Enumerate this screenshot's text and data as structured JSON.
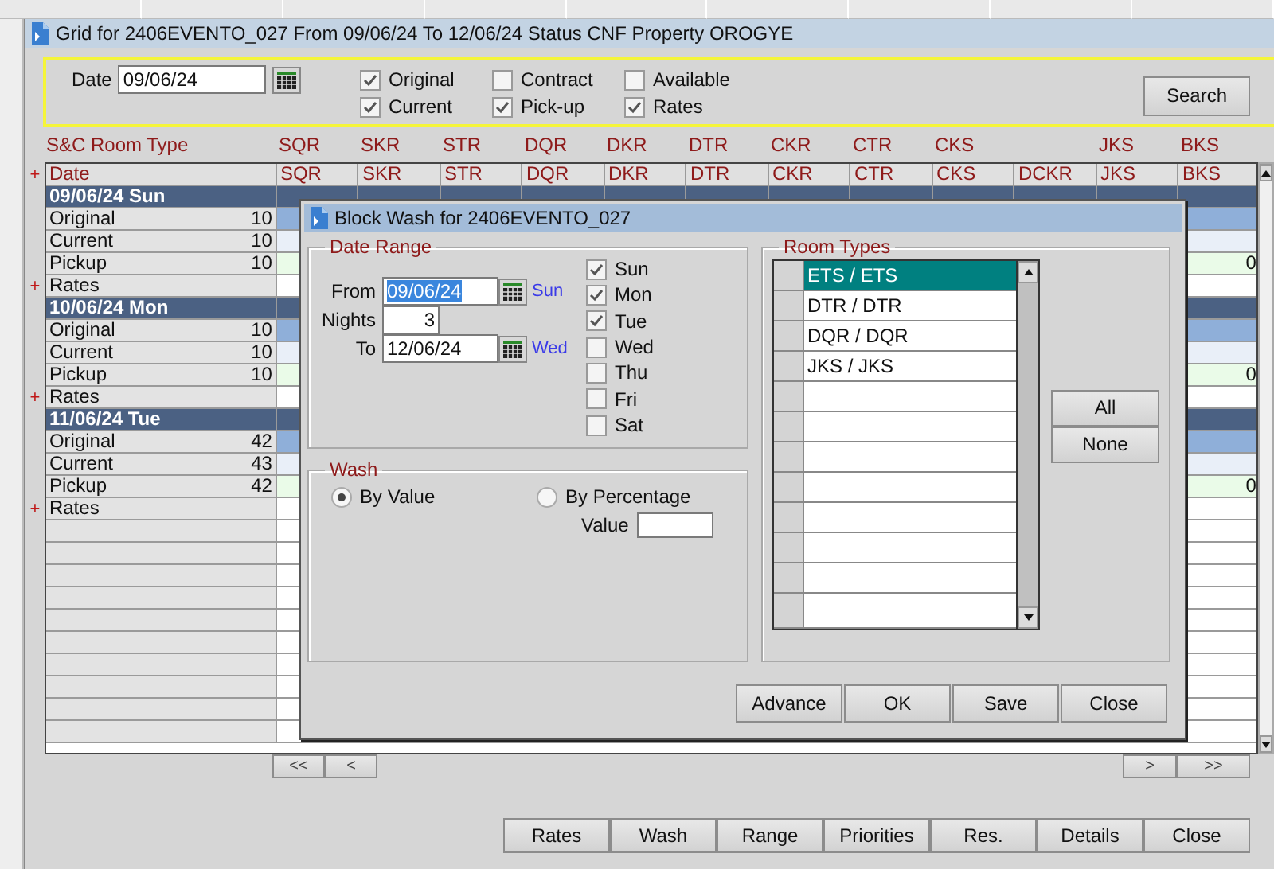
{
  "window": {
    "title": "Grid for 2406EVENTO_027 From 09/06/24 To 12/06/24 Status CNF Property OROGYE"
  },
  "filter": {
    "date_label": "Date",
    "date_value": "09/06/24",
    "options": [
      {
        "label": "Original",
        "checked": true
      },
      {
        "label": "Current",
        "checked": true
      },
      {
        "label": "Contract",
        "checked": false
      },
      {
        "label": "Pick-up",
        "checked": true
      },
      {
        "label": "Available",
        "checked": false
      },
      {
        "label": "Rates",
        "checked": true
      }
    ],
    "search_button": "Search"
  },
  "grid": {
    "room_type_label": "S&C Room Type",
    "date_heading": "Date",
    "date_marker": "+",
    "columns": [
      {
        "code": "SQR",
        "room_type": "SQR"
      },
      {
        "code": "SKR",
        "room_type": "SKR"
      },
      {
        "code": "STR",
        "room_type": "STR"
      },
      {
        "code": "DQR",
        "room_type": "DQR"
      },
      {
        "code": "DKR",
        "room_type": "DKR"
      },
      {
        "code": "DTR",
        "room_type": "DTR"
      },
      {
        "code": "CKR",
        "room_type": "CKR"
      },
      {
        "code": "CTR",
        "room_type": "CTR"
      },
      {
        "code": "CKS",
        "room_type": "CKS"
      },
      {
        "code": "DCKR"
      },
      {
        "code": "JKS",
        "room_type": "JKS"
      },
      {
        "code": "BKS",
        "room_type": "BKS"
      }
    ],
    "rows": [
      {
        "kind": "date",
        "label": "09/06/24 Sun"
      },
      {
        "kind": "original",
        "label": "Original",
        "value": "10"
      },
      {
        "kind": "current",
        "label": "Current",
        "value": "10"
      },
      {
        "kind": "pickup",
        "label": "Pickup",
        "value": "10",
        "last_column_value": "0"
      },
      {
        "kind": "rates",
        "label": "Rates",
        "marker": "+"
      },
      {
        "kind": "date",
        "label": "10/06/24 Mon"
      },
      {
        "kind": "original",
        "label": "Original",
        "value": "10"
      },
      {
        "kind": "current",
        "label": "Current",
        "value": "10"
      },
      {
        "kind": "pickup",
        "label": "Pickup",
        "value": "10",
        "last_column_value": "0"
      },
      {
        "kind": "rates",
        "label": "Rates",
        "marker": "+"
      },
      {
        "kind": "date",
        "label": "11/06/24 Tue"
      },
      {
        "kind": "original",
        "label": "Original",
        "value": "42"
      },
      {
        "kind": "current",
        "label": "Current",
        "value": "43"
      },
      {
        "kind": "pickup",
        "label": "Pickup",
        "value": "42",
        "last_column_value": "0"
      },
      {
        "kind": "rates",
        "label": "Rates",
        "marker": "+"
      }
    ]
  },
  "navigation": {
    "left_buttons": [
      "<<",
      "<"
    ],
    "right_buttons": [
      ">",
      ">>"
    ]
  },
  "actions": [
    "Rates",
    "Wash",
    "Range",
    "Priorities",
    "Res.",
    "Details",
    "Close"
  ],
  "dialog": {
    "title": "Block Wash for 2406EVENTO_027",
    "date_range": {
      "title": "Date Range",
      "from_label": "From",
      "from_value": "09/06/24",
      "from_value_selected": true,
      "from_day": "Sun",
      "nights_label": "Nights",
      "nights_value": "3",
      "to_label": "To",
      "to_value": "12/06/24",
      "to_day": "Wed",
      "days": [
        {
          "label": "Sun",
          "checked": true
        },
        {
          "label": "Mon",
          "checked": true
        },
        {
          "label": "Tue",
          "checked": true
        },
        {
          "label": "Wed",
          "checked": false
        },
        {
          "label": "Thu",
          "checked": false
        },
        {
          "label": "Fri",
          "checked": false
        },
        {
          "label": "Sat",
          "checked": false
        }
      ]
    },
    "wash": {
      "title": "Wash",
      "options": [
        {
          "label": "By Value",
          "selected": true
        },
        {
          "label": "By Percentage",
          "selected": false
        }
      ],
      "value_label": "Value"
    },
    "room_types": {
      "title": "Room Types",
      "items": [
        {
          "label": "ETS / ETS",
          "selected": true
        },
        {
          "label": "DTR / DTR",
          "selected": false
        },
        {
          "label": "DQR / DQR",
          "selected": false
        },
        {
          "label": "JKS / JKS",
          "selected": false
        }
      ]
    },
    "side_buttons": [
      "All",
      "None"
    ],
    "buttons": [
      "Advance",
      "OK",
      "Save",
      "Close"
    ]
  }
}
